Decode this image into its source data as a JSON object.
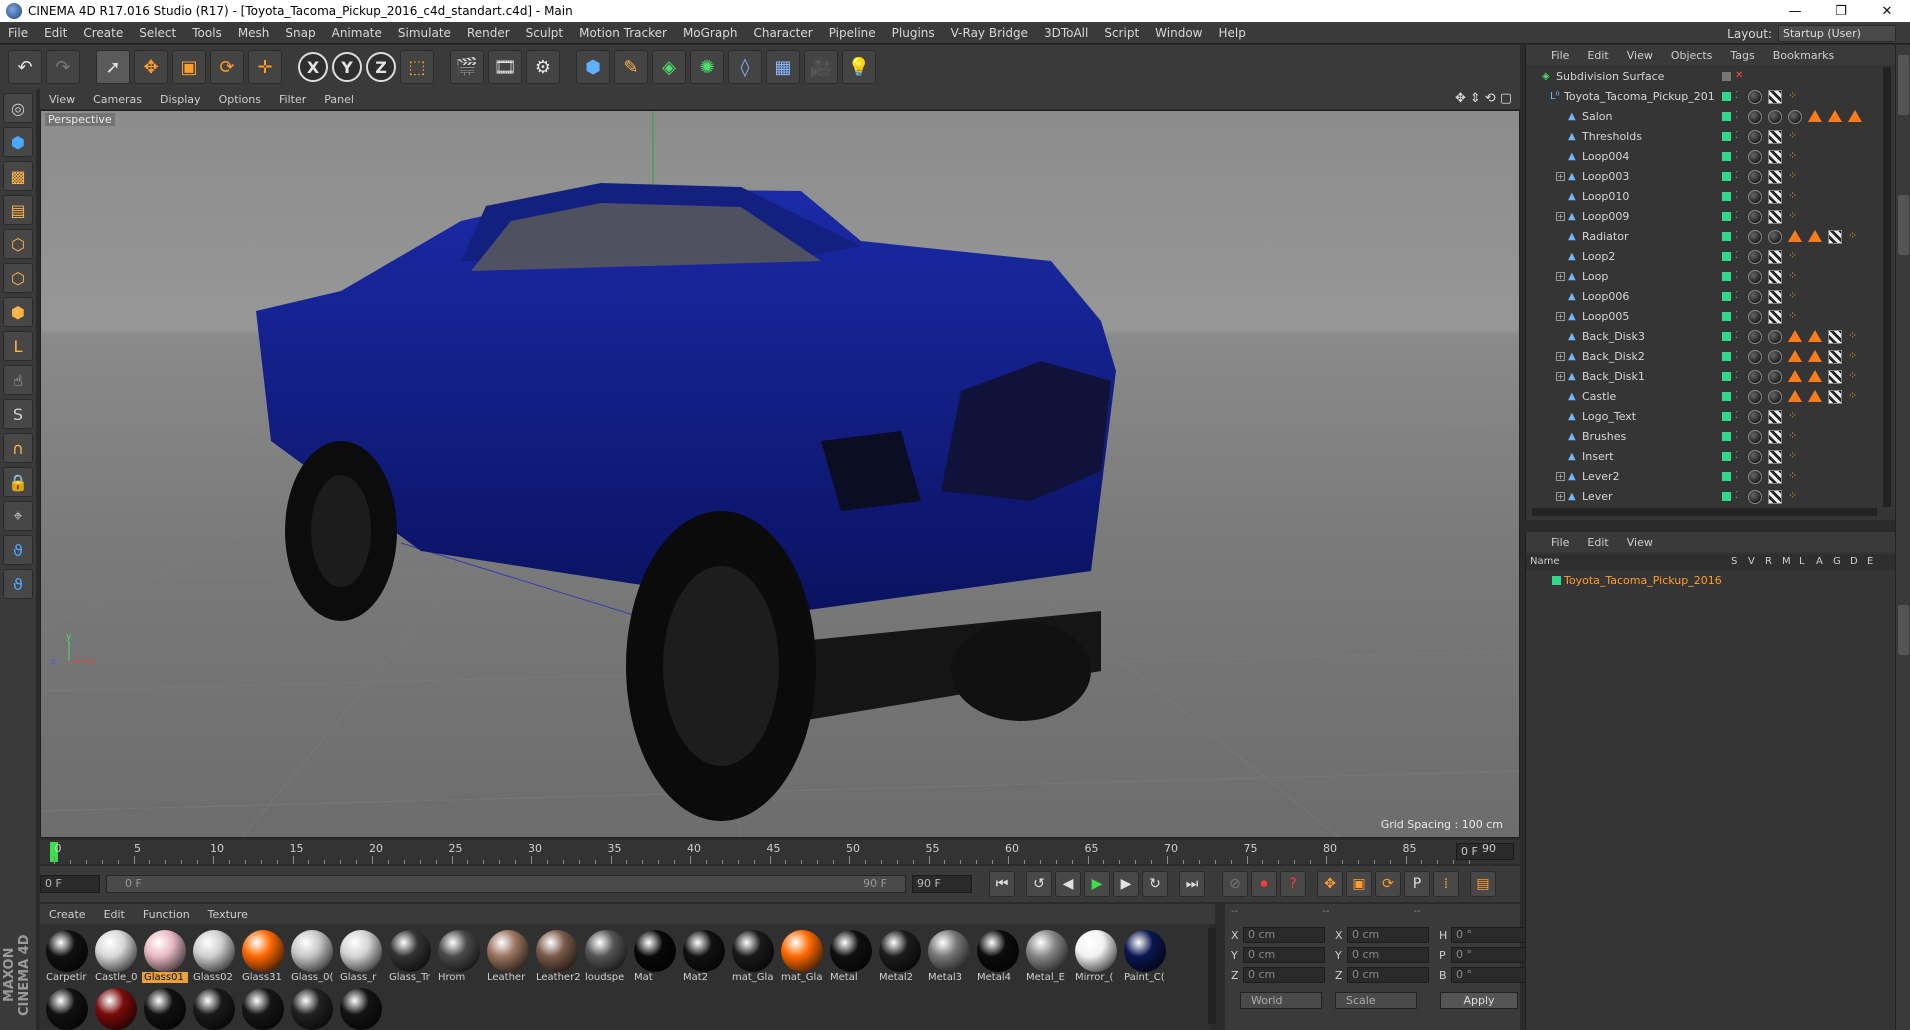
{
  "window": {
    "title": "CINEMA 4D R17.016 Studio (R17) - [Toyota_Tacoma_Pickup_2016_c4d_standart.c4d] - Main",
    "minimize": "—",
    "restore": "❐",
    "close": "✕"
  },
  "menubar": [
    "File",
    "Edit",
    "Create",
    "Select",
    "Tools",
    "Mesh",
    "Snap",
    "Animate",
    "Simulate",
    "Render",
    "Sculpt",
    "Motion Tracker",
    "MoGraph",
    "Character",
    "Pipeline",
    "Plugins",
    "V-Ray Bridge",
    "3DToAll",
    "Script",
    "Window",
    "Help"
  ],
  "layout": {
    "label": "Layout:",
    "value": "Startup (User)"
  },
  "viewport": {
    "menu": [
      "View",
      "Cameras",
      "Display",
      "Options",
      "Filter",
      "Panel"
    ],
    "label": "Perspective",
    "grid_spacing": "Grid Spacing : 100 cm"
  },
  "timeline": {
    "ticks": [
      "0",
      "5",
      "10",
      "15",
      "20",
      "25",
      "30",
      "35",
      "40",
      "45",
      "50",
      "55",
      "60",
      "65",
      "70",
      "75",
      "80",
      "85",
      "90"
    ],
    "current": "0 F"
  },
  "transport": {
    "start": "0 F",
    "range_start": "0 F",
    "range_end": "90 F",
    "end": "90 F"
  },
  "material_manager": {
    "menu": [
      "Create",
      "Edit",
      "Function",
      "Texture"
    ],
    "logo": "MAXON CINEMA 4D",
    "materials": [
      {
        "name": "Carpetir",
        "color": "#111111"
      },
      {
        "name": "Castle_0",
        "color": "#d8d8d8"
      },
      {
        "name": "Glass01",
        "color": "#e9b9c4",
        "selected": true
      },
      {
        "name": "Glass02",
        "color": "#cfcfcf"
      },
      {
        "name": "Glass31",
        "color": "#ff6a00"
      },
      {
        "name": "Glass_0(",
        "color": "#c8c8c8"
      },
      {
        "name": "Glass_r",
        "color": "#d4d4d4"
      },
      {
        "name": "Glass_Tr",
        "color": "#333333"
      },
      {
        "name": "Hrom",
        "color": "#4a4a4a"
      },
      {
        "name": "Leather",
        "color": "#9a7460"
      },
      {
        "name": "Leather2",
        "color": "#7a5a4a"
      },
      {
        "name": "loudspe",
        "color": "#555555"
      },
      {
        "name": "Mat",
        "color": "#080808"
      },
      {
        "name": "Mat2",
        "color": "#111111"
      },
      {
        "name": "mat_Gla",
        "color": "#1a1a1a"
      },
      {
        "name": "mat_Gla",
        "color": "#ff6a00"
      },
      {
        "name": "Metal",
        "color": "#101010"
      },
      {
        "name": "Metal2",
        "color": "#1c1c1c"
      },
      {
        "name": "Metal3",
        "color": "#777777"
      },
      {
        "name": "Metal4",
        "color": "#0c0c0c"
      },
      {
        "name": "Metal_E",
        "color": "#888888"
      },
      {
        "name": "Mirror_(",
        "color": "#f2f2f2"
      },
      {
        "name": "Paint_C(",
        "color": "#0a1650"
      }
    ],
    "second_row": [
      "#111111",
      "#7a0b0b",
      "#111111",
      "#1a1a1a",
      "#161616",
      "#222222",
      "#141414"
    ]
  },
  "coordinates": {
    "headers": [
      "--",
      "--",
      "--"
    ],
    "rows": [
      {
        "a": "X",
        "av": "0 cm",
        "b": "X",
        "bv": "0 cm",
        "c": "H",
        "cv": "0 °"
      },
      {
        "a": "Y",
        "av": "0 cm",
        "b": "Y",
        "bv": "0 cm",
        "c": "P",
        "cv": "0 °"
      },
      {
        "a": "Z",
        "av": "0 cm",
        "b": "Z",
        "bv": "0 cm",
        "c": "B",
        "cv": "0 °"
      }
    ],
    "mode": "World",
    "size_mode": "Scale",
    "apply": "Apply"
  },
  "object_manager": {
    "menu": [
      "File",
      "Edit",
      "View",
      "Objects",
      "Tags",
      "Bookmarks"
    ],
    "items": [
      {
        "name": "Subdivision Surface",
        "level": 0
      },
      {
        "name": "Toyota_Tacoma_Pickup_201",
        "level": 1
      },
      {
        "name": "Salon",
        "level": 2
      },
      {
        "name": "Thresholds",
        "level": 2
      },
      {
        "name": "Loop004",
        "level": 2
      },
      {
        "name": "Loop003",
        "level": 2
      },
      {
        "name": "Loop010",
        "level": 2
      },
      {
        "name": "Loop009",
        "level": 2
      },
      {
        "name": "Radiator",
        "level": 2
      },
      {
        "name": "Loop2",
        "level": 2
      },
      {
        "name": "Loop",
        "level": 2
      },
      {
        "name": "Loop006",
        "level": 2
      },
      {
        "name": "Loop005",
        "level": 2
      },
      {
        "name": "Back_Disk3",
        "level": 2
      },
      {
        "name": "Back_Disk2",
        "level": 2
      },
      {
        "name": "Back_Disk1",
        "level": 2
      },
      {
        "name": "Castle",
        "level": 2
      },
      {
        "name": "Logo_Text",
        "level": 2
      },
      {
        "name": "Brushes",
        "level": 2
      },
      {
        "name": "Insert",
        "level": 2
      },
      {
        "name": "Lever2",
        "level": 2
      },
      {
        "name": "Lever",
        "level": 2
      }
    ]
  },
  "layer_manager": {
    "menu": [
      "File",
      "Edit",
      "View"
    ],
    "columns": [
      "Name",
      "S",
      "V",
      "R",
      "M",
      "L",
      "A",
      "G",
      "D",
      "E"
    ],
    "layer": "Toyota_Tacoma_Pickup_2016"
  },
  "colors": {
    "accent": "#ff9d2a",
    "playhead": "#3ae04c",
    "truck": "#0e1a7a"
  }
}
